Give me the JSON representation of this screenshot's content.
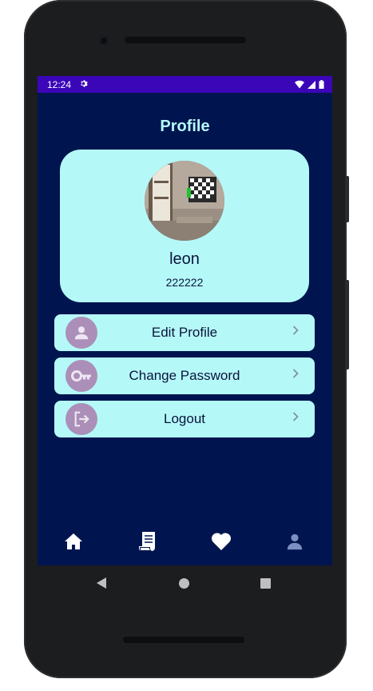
{
  "status_bar": {
    "time": "12:24"
  },
  "page": {
    "title": "Profile"
  },
  "profile": {
    "name": "leon",
    "subtitle": "222222"
  },
  "menu": [
    {
      "label": "Edit Profile",
      "icon": "person-icon"
    },
    {
      "label": "Change Password",
      "icon": "key-icon"
    },
    {
      "label": "Logout",
      "icon": "logout-icon"
    }
  ],
  "bottom_nav": [
    {
      "icon": "home-icon",
      "active": false
    },
    {
      "icon": "receipt-icon",
      "active": false
    },
    {
      "icon": "heart-icon",
      "active": false
    },
    {
      "icon": "person-icon",
      "active": true
    }
  ],
  "colors": {
    "background": "#00154f",
    "card": "#b5f8f8",
    "status_bar": "#3b06b8",
    "icon_circle": "#ab8fb8",
    "title": "#b5f8f8"
  }
}
